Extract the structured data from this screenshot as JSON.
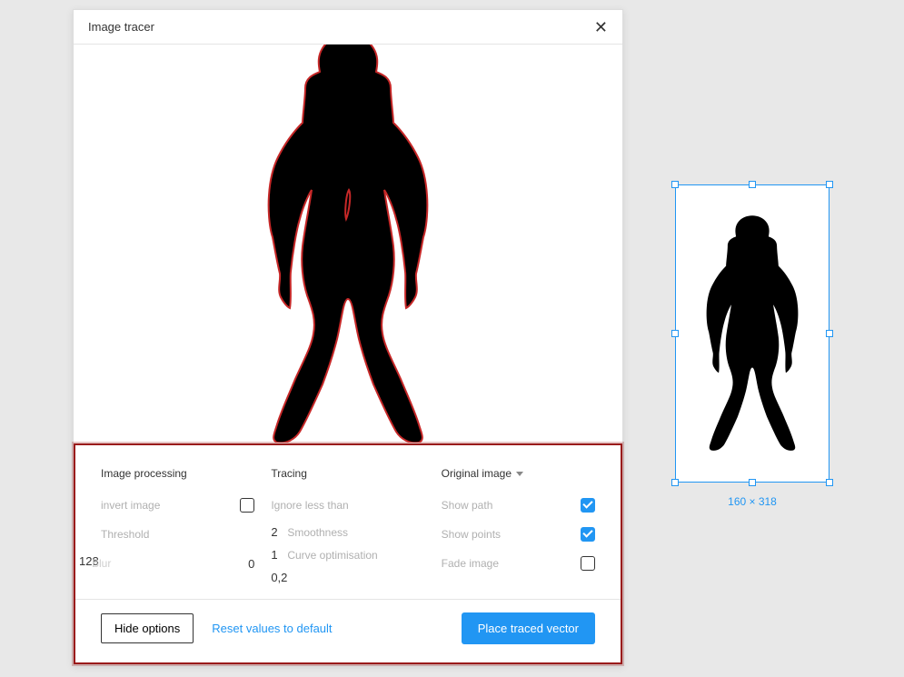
{
  "dialog": {
    "title": "Image tracer"
  },
  "image_processing": {
    "heading": "Image processing",
    "invert_label": "invert image",
    "invert_checked": false,
    "threshold_label": "Threshold",
    "threshold_value": "128",
    "blur_label": "Blur",
    "blur_value": "0"
  },
  "tracing": {
    "heading": "Tracing",
    "ignore_label": "Ignore less than",
    "ignore_value": "2",
    "smoothness_label": "Smoothness",
    "smoothness_value": "1",
    "curve_label": "Curve optimisation",
    "curve_value": "0,2"
  },
  "display": {
    "dropdown_label": "Original image",
    "show_path_label": "Show path",
    "show_path_checked": true,
    "show_points_label": "Show points",
    "show_points_checked": true,
    "fade_label": "Fade image",
    "fade_checked": false
  },
  "footer": {
    "hide_options": "Hide options",
    "reset": "Reset values to default",
    "place": "Place traced vector"
  },
  "selection": {
    "dimensions": "160 × 318"
  }
}
